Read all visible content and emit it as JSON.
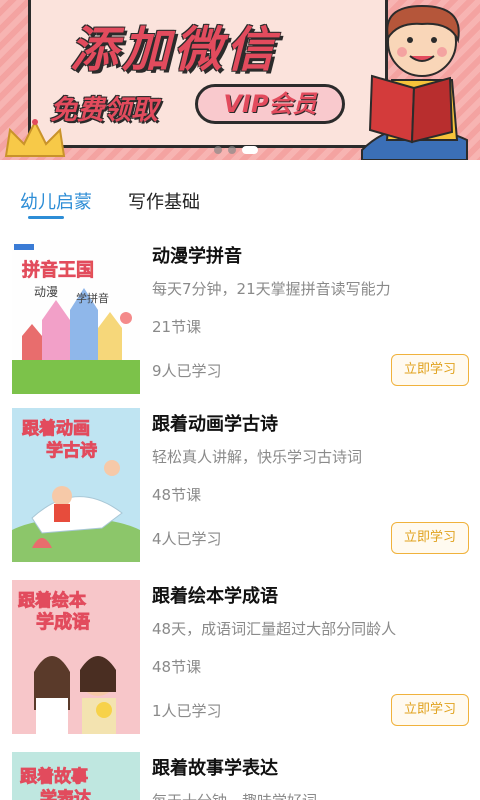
{
  "banner": {
    "title": "添加微信",
    "subtitle": "免费领取",
    "vip": "VIP会员"
  },
  "tabs": [
    {
      "label": "幼儿启蒙",
      "active": true
    },
    {
      "label": "写作基础",
      "active": false
    }
  ],
  "courses": [
    {
      "title": "动漫学拼音",
      "desc": "每天7分钟，21天掌握拼音读写能力",
      "lessons": "21节课",
      "learners": "9人已学习",
      "button": "立即学习",
      "cover_text": "拼音王国",
      "cover_sub1": "动漫",
      "cover_sub2": "学拼音"
    },
    {
      "title": "跟着动画学古诗",
      "desc": "轻松真人讲解，快乐学习古诗词",
      "lessons": "48节课",
      "learners": "4人已学习",
      "button": "立即学习",
      "cover_text": "跟着动画",
      "cover_sub1": "学古诗"
    },
    {
      "title": "跟着绘本学成语",
      "desc": "48天，成语词汇量超过大部分同龄人",
      "lessons": "48节课",
      "learners": "1人已学习",
      "button": "立即学习",
      "cover_text": "跟着绘本",
      "cover_sub1": "学成语"
    },
    {
      "title": "跟着故事学表达",
      "desc": "每天十分钟，趣味学好词",
      "cover_text": "跟着故事",
      "cover_sub1": "学表达"
    }
  ],
  "colors": {
    "accent": "#2d8dd6",
    "button": "#f0b23c",
    "banner_pink": "#f4a3a1",
    "banner_red": "#e24b5d"
  }
}
